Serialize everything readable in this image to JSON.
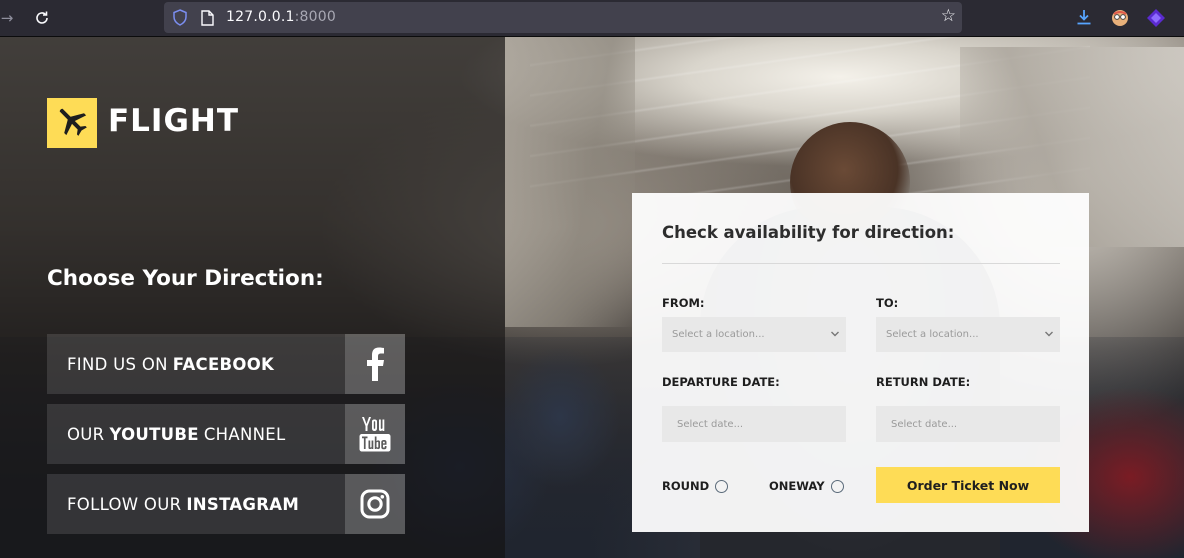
{
  "browser": {
    "url_host": "127.0.0.1",
    "url_port": ":8000",
    "icons": [
      "back-icon",
      "reload-icon",
      "shield-icon",
      "page-icon",
      "bookmark-star-icon",
      "download-icon",
      "extension-icon",
      "extension-icon"
    ]
  },
  "logo": {
    "text": "FLIGHT",
    "icon": "airplane-icon",
    "color": "#fedc56"
  },
  "left": {
    "heading": "Choose Your Direction:",
    "social": [
      {
        "pre": "FIND US ON",
        "bold": "FACEBOOK",
        "post": "",
        "icon": "facebook-icon"
      },
      {
        "pre": "OUR",
        "bold": "YOUTUBE",
        "post": "CHANNEL",
        "icon": "youtube-icon"
      },
      {
        "pre": "FOLLOW OUR",
        "bold": "INSTAGRAM",
        "post": "",
        "icon": "instagram-icon"
      }
    ]
  },
  "form": {
    "title": "Check availability for direction:",
    "from_label": "FROM:",
    "from_placeholder": "Select a location...",
    "to_label": "TO:",
    "to_placeholder": "Select a location...",
    "departure_label": "DEPARTURE DATE:",
    "departure_placeholder": "Select date...",
    "return_label": "RETURN DATE:",
    "return_placeholder": "Select date...",
    "round_label": "ROUND",
    "oneway_label": "ONEWAY",
    "order_button": "Order Ticket Now",
    "accent_color": "#fedc56"
  }
}
